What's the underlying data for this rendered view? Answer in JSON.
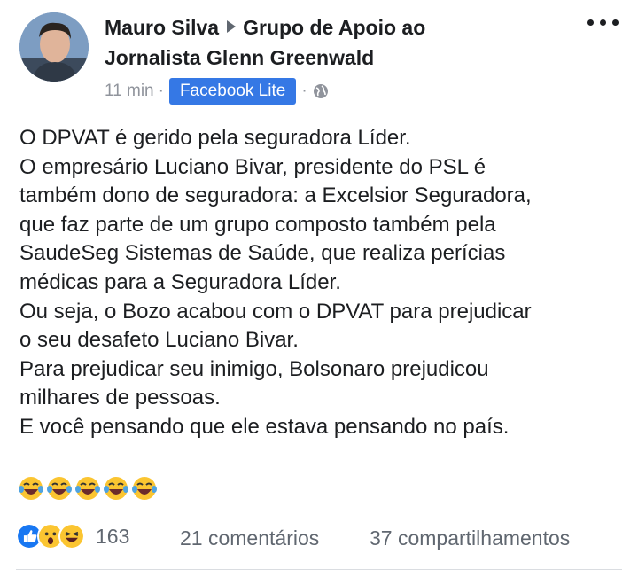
{
  "post": {
    "author": "Mauro Silva",
    "group_line1": "Grupo de Apoio ao",
    "group_line2": "Jornalista Glenn Greenwald",
    "time": "11 min",
    "app": "Facebook Lite",
    "dot": "·",
    "body": [
      "O DPVAT é gerido pela seguradora Líder.",
      "O empresário Luciano Bivar, presidente do PSL é",
      "também dono de seguradora: a Excelsior Seguradora,",
      "que faz parte de um grupo composto também pela",
      "SaudeSeg Sistemas de Saúde, que realiza perícias",
      "médicas para a Seguradora Líder.",
      "Ou seja, o Bozo acabou com o DPVAT para prejudicar",
      "o seu desafeto Luciano Bivar.",
      "Para prejudicar seu inimigo, Bolsonaro prejudicou",
      "milhares de pessoas.",
      "E você pensando que ele estava pensando no país."
    ],
    "emoji_icons": [
      "laughing-crying-icon",
      "laughing-crying-icon",
      "laughing-crying-icon",
      "laughing-crying-icon",
      "laughing-crying-icon"
    ]
  },
  "footer": {
    "reaction_icons": [
      "like-icon",
      "wow-icon",
      "haha-icon"
    ],
    "reaction_count": "163",
    "comments": "21 comentários",
    "shares": "37 compartilhamentos"
  },
  "colors": {
    "accent": "#3578e5",
    "text": "#1c1e21",
    "muted": "#606770"
  }
}
